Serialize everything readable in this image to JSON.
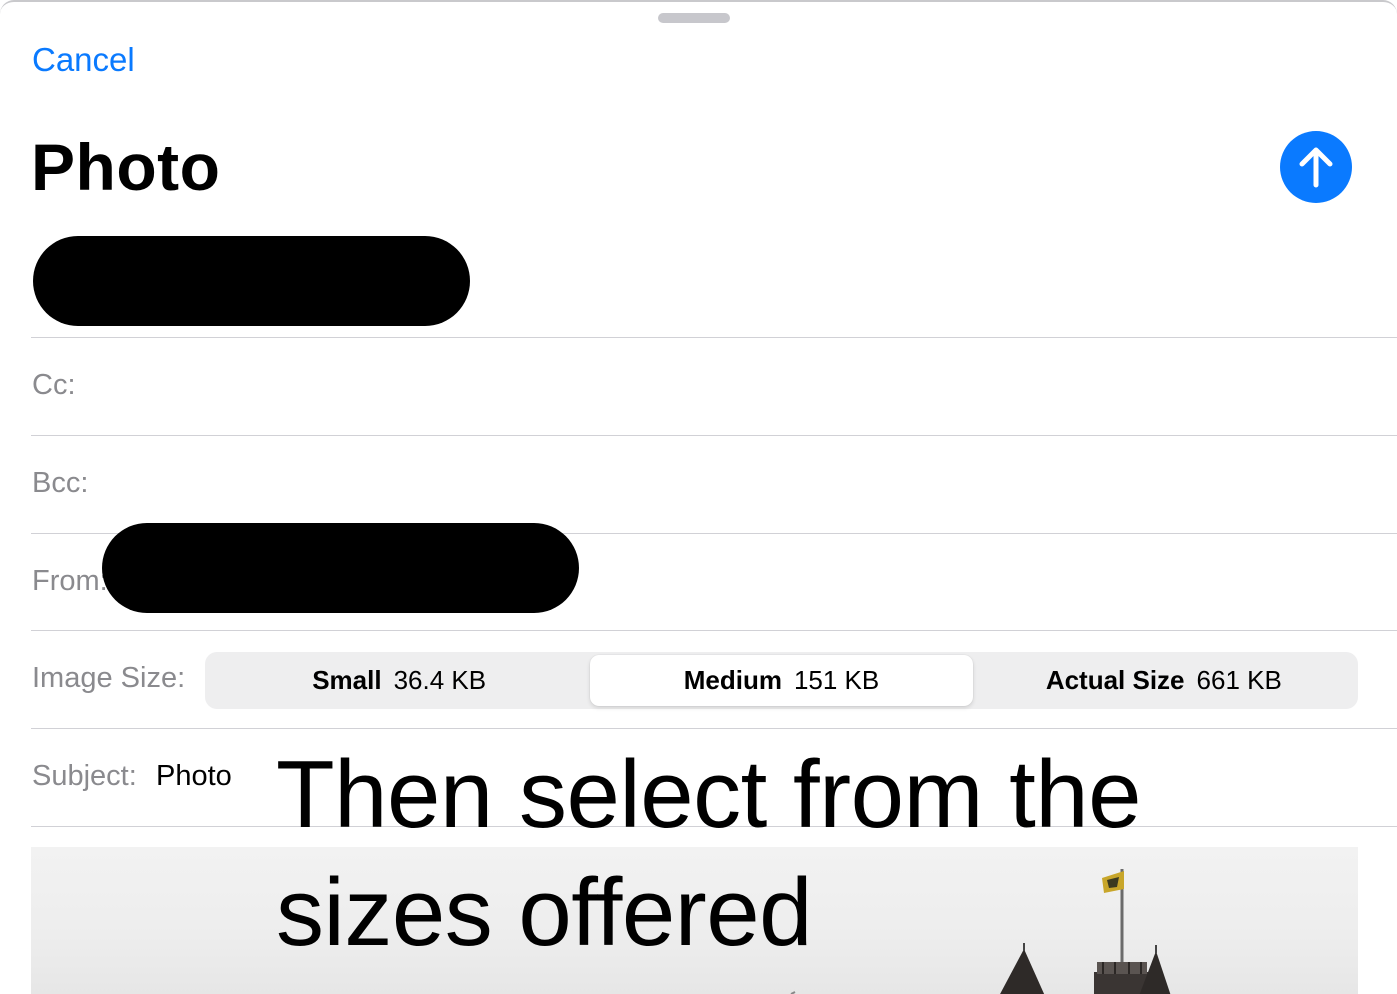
{
  "header": {
    "cancel_label": "Cancel",
    "title": "Photo",
    "send_icon": "arrow-up-icon",
    "accent_color": "#0a7aff"
  },
  "fields": {
    "cc_label": "Cc:",
    "bcc_label": "Bcc:",
    "from_label": "From:",
    "image_size_label": "Image Size:",
    "subject_label": "Subject:",
    "subject_value": "Photo"
  },
  "image_size_options": [
    {
      "name": "Small",
      "size": "36.4 KB",
      "selected": false
    },
    {
      "name": "Medium",
      "size": "151 KB",
      "selected": true
    },
    {
      "name": "Actual Size",
      "size": "661 KB",
      "selected": false
    }
  ],
  "overlay": {
    "caption": "Then select from the sizes offered"
  }
}
